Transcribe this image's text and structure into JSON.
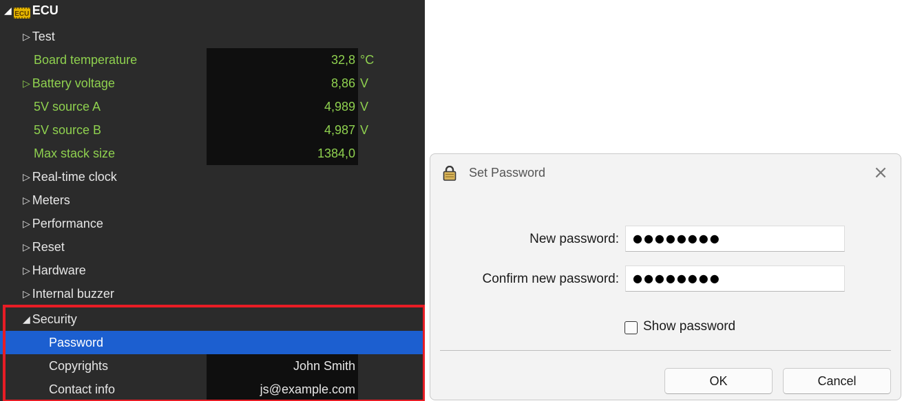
{
  "tree": {
    "root": {
      "label": "ECU",
      "chip_text": "ECU"
    },
    "test": {
      "label": "Test"
    },
    "measurements": [
      {
        "label": "Board temperature",
        "value": "32,8",
        "unit": "°C",
        "expandable": false
      },
      {
        "label": "Battery voltage",
        "value": "8,86",
        "unit": "V",
        "expandable": true
      },
      {
        "label": "5V source A",
        "value": "4,989",
        "unit": "V",
        "expandable": false
      },
      {
        "label": "5V source B",
        "value": "4,987",
        "unit": "V",
        "expandable": false
      },
      {
        "label": "Max stack size",
        "value": "1384,0",
        "unit": "",
        "expandable": false
      }
    ],
    "groups": [
      "Real-time clock",
      "Meters",
      "Performance",
      "Reset",
      "Hardware",
      "Internal buzzer"
    ],
    "security": {
      "label": "Security",
      "items": [
        {
          "label": "Password",
          "value": ""
        },
        {
          "label": "Copyrights",
          "value": "John Smith"
        },
        {
          "label": "Contact info",
          "value": "js@example.com"
        }
      ]
    },
    "colors": {
      "value_text": "#8fd14f",
      "selection": "#1c5fd0",
      "highlight_border": "#e81d25"
    }
  },
  "dialog": {
    "title": "Set Password",
    "icon": "lock-icon",
    "new_password_label": "New password:",
    "new_password_value": "●●●●●●●●",
    "confirm_password_label": "Confirm new password:",
    "confirm_password_value": "●●●●●●●●",
    "show_password_label": "Show password",
    "show_password_checked": false,
    "ok_label": "OK",
    "cancel_label": "Cancel",
    "close_glyph": "×"
  }
}
